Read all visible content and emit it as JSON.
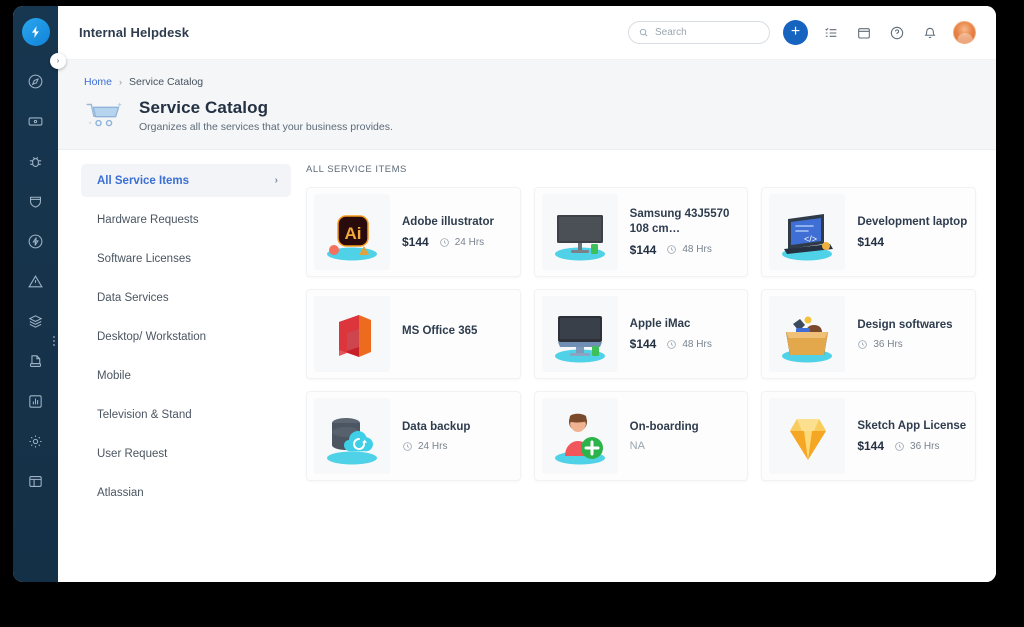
{
  "window": {
    "app_title": "Internal Helpdesk"
  },
  "rail": {
    "logo_icon": "lightning-bolt-logo",
    "toggle_icon": "chevron-right-icon",
    "overflow_icon": "more-vertical-icon",
    "items": [
      {
        "icon": "compass-icon",
        "name": "dashboard"
      },
      {
        "icon": "ticket-icon",
        "name": "tickets"
      },
      {
        "icon": "bug-icon",
        "name": "problems"
      },
      {
        "icon": "shield-icon",
        "name": "changes"
      },
      {
        "icon": "flash-circle-icon",
        "name": "incidents"
      },
      {
        "icon": "warning-triangle-icon",
        "name": "alerts"
      },
      {
        "icon": "layers-icon",
        "name": "assets"
      },
      {
        "icon": "document-icon",
        "name": "knowledge"
      },
      {
        "icon": "bar-chart-icon",
        "name": "reports"
      },
      {
        "icon": "gear-icon",
        "name": "settings"
      },
      {
        "icon": "table-icon",
        "name": "workspace"
      }
    ]
  },
  "topbar": {
    "search": {
      "placeholder": "Search",
      "value": "",
      "icon": "search-icon"
    },
    "add_button": {
      "label": "+",
      "icon": "plus-icon",
      "color": "#1764c0"
    },
    "icons": [
      {
        "name": "checklist-icon"
      },
      {
        "name": "calendar-icon"
      },
      {
        "name": "help-circle-icon"
      },
      {
        "name": "bell-icon"
      }
    ],
    "avatar": {
      "name": "user-avatar"
    }
  },
  "page": {
    "breadcrumb": {
      "home": "Home",
      "separator": "›",
      "current": "Service Catalog"
    },
    "icon": "shopping-cart-icon",
    "title": "Service Catalog",
    "subtitle": "Organizes all the services that your business provides."
  },
  "categories": {
    "items": [
      {
        "label": "All Service Items",
        "active": true,
        "chevron": "›"
      },
      {
        "label": "Hardware Requests",
        "active": false
      },
      {
        "label": "Software Licenses",
        "active": false
      },
      {
        "label": "Data Services",
        "active": false
      },
      {
        "label": "Desktop/ Workstation",
        "active": false
      },
      {
        "label": "Mobile",
        "active": false
      },
      {
        "label": "Television & Stand",
        "active": false
      },
      {
        "label": "User Request",
        "active": false
      },
      {
        "label": "Atlassian",
        "active": false
      }
    ]
  },
  "catalog": {
    "caption": "ALL SERVICE ITEMS",
    "items": [
      {
        "name": "Adobe illustrator",
        "price": "$144",
        "duration": "24 Hrs",
        "icon": "adobe-illustrator-icon"
      },
      {
        "name": "Samsung 43J5570 108 cm…",
        "price": "$144",
        "duration": "48 Hrs",
        "icon": "television-icon"
      },
      {
        "name": "Development laptop",
        "price": "$144",
        "duration": "",
        "icon": "laptop-code-icon"
      },
      {
        "name": "MS Office 365",
        "price": "",
        "duration": "",
        "icon": "ms-office-icon"
      },
      {
        "name": "Apple iMac",
        "price": "$144",
        "duration": "48 Hrs",
        "icon": "imac-icon"
      },
      {
        "name": "Design softwares",
        "price": "",
        "duration": "36 Hrs",
        "icon": "design-box-icon"
      },
      {
        "name": "Data backup",
        "price": "",
        "duration": "24 Hrs",
        "icon": "database-cloud-icon"
      },
      {
        "name": "On-boarding",
        "price": "NA",
        "duration": "",
        "icon": "user-add-icon"
      },
      {
        "name": "Sketch App License",
        "price": "$144",
        "duration": "36 Hrs",
        "icon": "sketch-diamond-icon"
      }
    ]
  },
  "colors": {
    "rail_bg": "#173754",
    "accent_blue": "#3b6fd4",
    "add_button": "#1764c0",
    "page_band": "#f4f6f8"
  }
}
